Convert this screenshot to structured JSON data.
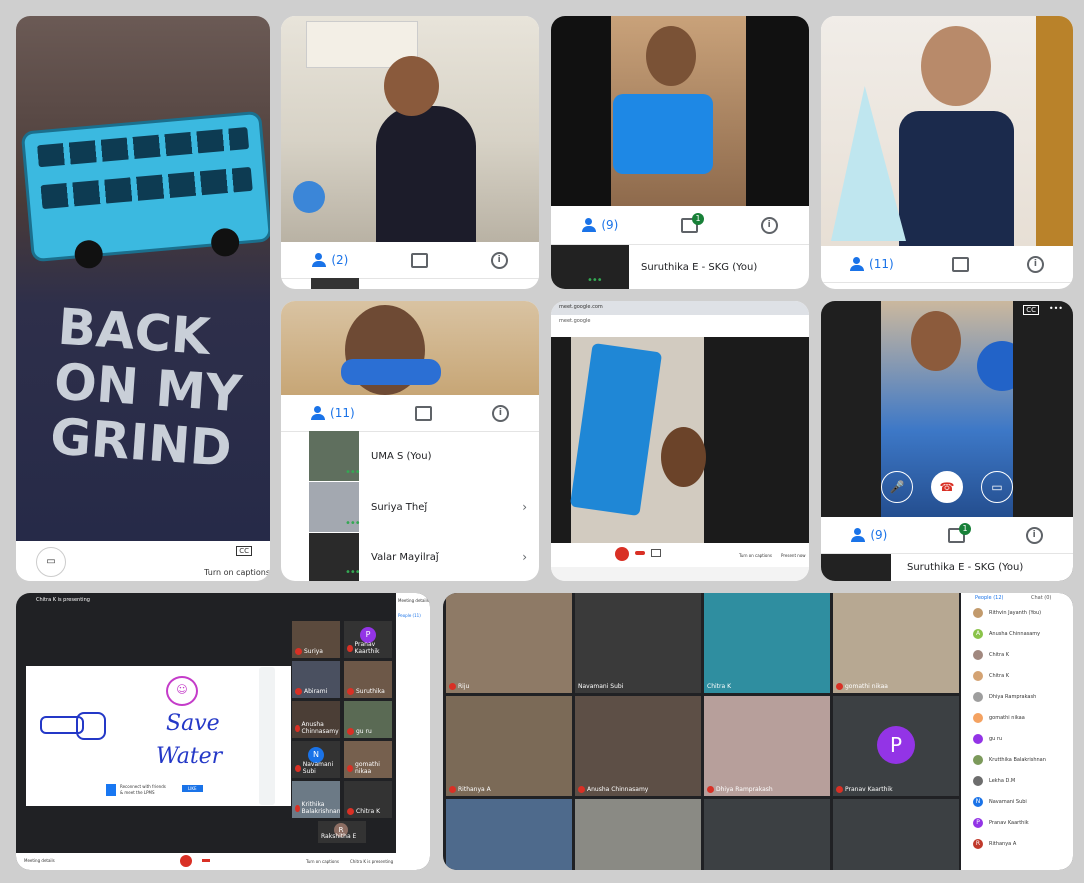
{
  "panel1": {
    "caption_label": "Turn on captions",
    "cc_label": "CC"
  },
  "panel2": {
    "people_count": "(2)"
  },
  "panel3": {
    "people_count": "(9)",
    "chat_badge": "1",
    "participant_name": "Suruthika E - SKG (You)"
  },
  "panel4": {
    "people_count": "(11)"
  },
  "panel5": {
    "people_count": "(11)",
    "participants": [
      {
        "name": "UMA S (You)"
      },
      {
        "name": "Suriya Theǰ"
      },
      {
        "name": "Valar Mayilraǰ"
      }
    ]
  },
  "panel6": {
    "tab_title": "meet.google.com",
    "url": "meet.google",
    "turn_on_captions": "Turn on captions",
    "present_now": "Present now"
  },
  "panel7": {
    "cc_label": "CC",
    "more_label": "•••",
    "people_count": "(9)",
    "chat_badge": "1",
    "participant_name": "Suruthika E - SKG (You)"
  },
  "panel8": {
    "presenting_text": "Chitra K is presenting",
    "slide_title_1": "Save",
    "slide_title_2": "Water",
    "share_line_1": "Reconnect with friends",
    "share_line_2": "& meet the LPMS",
    "share_button": "LIKE",
    "meeting_details": "Meeting details",
    "turn_on_captions": "Turn on captions",
    "present_label": "Chitra K is presenting",
    "side_header": "Meeting details",
    "people_tab": "People (11)",
    "tiles": [
      {
        "name": "Suriya"
      },
      {
        "name": "Pranav Kaarthik",
        "initial": "P"
      },
      {
        "name": "Abirami"
      },
      {
        "name": "Suruthika"
      },
      {
        "name": "Anusha Chinnasamy"
      },
      {
        "name": "gu ru"
      },
      {
        "name": "Navamani Subi",
        "initial": "N"
      },
      {
        "name": "gomathi nikaa"
      },
      {
        "name": "Krithika Balakrishnan"
      },
      {
        "name": "Chitra K"
      },
      {
        "name": "Rakshitha E",
        "initial": "R"
      }
    ]
  },
  "panel9": {
    "tiles": [
      {
        "name": "Riju"
      },
      {
        "name": "Navamani Subi"
      },
      {
        "name": "Chitra K"
      },
      {
        "name": "gomathi nikaa"
      },
      {
        "name": "Rithanya A"
      },
      {
        "name": "Anusha Chinnasamy"
      },
      {
        "name": "Dhiya Ramprakash"
      },
      {
        "name": "Pranav Kaarthik",
        "initial": "P"
      }
    ],
    "people_tab": "People (12)",
    "chat_tab": "Chat (0)",
    "people": [
      {
        "name": "Rithvin Jayanth (You)",
        "initial": ""
      },
      {
        "name": "Anusha Chinnasamy",
        "initial": "A"
      },
      {
        "name": "Chitra K",
        "initial": ""
      },
      {
        "name": "Chitra K",
        "initial": ""
      },
      {
        "name": "Dhiya Ramprakash",
        "initial": ""
      },
      {
        "name": "gomathi nikaa",
        "initial": ""
      },
      {
        "name": "gu ru",
        "initial": ""
      },
      {
        "name": "Krutthika Balakrishnan",
        "initial": ""
      },
      {
        "name": "Lekha D.M",
        "initial": ""
      },
      {
        "name": "Navamani Subi",
        "initial": "N"
      },
      {
        "name": "Pranav Kaarthik",
        "initial": "P"
      },
      {
        "name": "Rithanya A",
        "initial": "R"
      }
    ]
  },
  "colors": {
    "meet_blue": "#1a73e8",
    "end_call_red": "#d93025",
    "green": "#34a853",
    "purple": "#9334e6"
  }
}
